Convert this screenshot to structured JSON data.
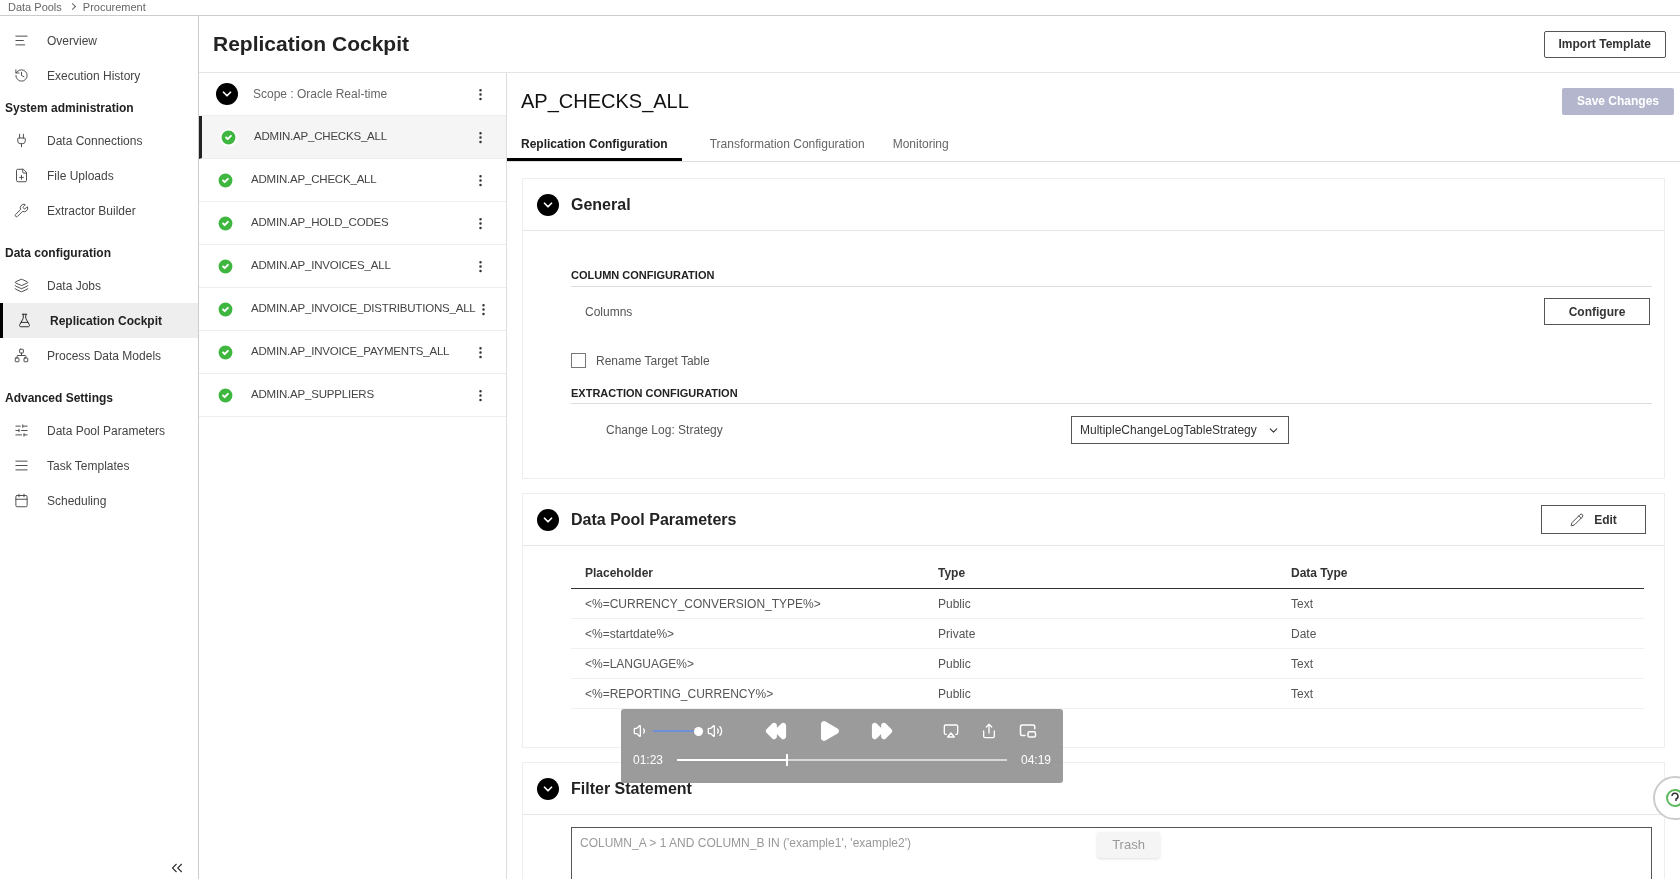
{
  "breadcrumb": [
    "Data Pools",
    "Procurement"
  ],
  "sidebar": {
    "groups": [
      {
        "items": [
          {
            "label": "Overview",
            "selected": false
          },
          {
            "label": "Execution History",
            "selected": false
          }
        ]
      },
      {
        "heading": "System administration",
        "items": [
          {
            "label": "Data Connections",
            "selected": false
          },
          {
            "label": "File Uploads",
            "selected": false
          },
          {
            "label": "Extractor Builder",
            "selected": false
          }
        ]
      },
      {
        "heading": "Data configuration",
        "items": [
          {
            "label": "Data Jobs",
            "selected": false
          },
          {
            "label": "Replication Cockpit",
            "selected": true
          },
          {
            "label": "Process Data Models",
            "selected": false
          }
        ]
      },
      {
        "heading": "Advanced Settings",
        "items": [
          {
            "label": "Data Pool Parameters",
            "selected": false
          },
          {
            "label": "Task Templates",
            "selected": false
          },
          {
            "label": "Scheduling",
            "selected": false
          }
        ]
      }
    ]
  },
  "page_title": "Replication Cockpit",
  "import_button": "Import Template",
  "scope": {
    "label": "Scope : Oracle Real-time",
    "expanded": true
  },
  "tables": [
    {
      "label": "ADMIN.AP_CHECKS_ALL",
      "success": true,
      "selected": true
    },
    {
      "label": "ADMIN.AP_CHECK_ALL",
      "success": true,
      "selected": false
    },
    {
      "label": "ADMIN.AP_HOLD_CODES",
      "success": true,
      "selected": false
    },
    {
      "label": "ADMIN.AP_INVOICES_ALL",
      "success": true,
      "selected": false
    },
    {
      "label": "ADMIN.AP_INVOICE_DISTRIBUTIONS_ALL",
      "success": true,
      "selected": false
    },
    {
      "label": "ADMIN.AP_INVOICE_PAYMENTS_ALL",
      "success": true,
      "selected": false
    },
    {
      "label": "ADMIN.AP_SUPPLIERS",
      "success": true,
      "selected": false
    }
  ],
  "detail": {
    "title": "AP_CHECKS_ALL",
    "save_button": {
      "label": "Save Changes",
      "disabled": true
    },
    "tabs": [
      {
        "label": "Replication Configuration",
        "selected": true
      },
      {
        "label": "Transformation Configuration",
        "selected": false
      },
      {
        "label": "Monitoring",
        "selected": false
      }
    ]
  },
  "general": {
    "title": "General",
    "expanded": true,
    "column_heading": "COLUMN CONFIGURATION",
    "columns_label": "Columns",
    "configure_button": "Configure",
    "rename": {
      "label": "Rename Target Table",
      "checked": false
    },
    "extraction_heading": "EXTRACTION CONFIGURATION",
    "strategy_label": "Change Log: Strategy",
    "strategy_value": "MultipleChangeLogTableStrategy"
  },
  "parameters": {
    "title": "Data Pool Parameters",
    "expanded": true,
    "edit_button": "Edit",
    "columns": [
      "Placeholder",
      "Type",
      "Data Type"
    ],
    "rows": [
      [
        "<%=CURRENCY_CONVERSION_TYPE%>",
        "Public",
        "Text"
      ],
      [
        "<%=startdate%>",
        "Private",
        "Date"
      ],
      [
        "<%=LANGUAGE%>",
        "Public",
        "Text"
      ],
      [
        "<%=REPORTING_CURRENCY%>",
        "Public",
        "Text"
      ]
    ]
  },
  "filter": {
    "title": "Filter Statement",
    "expanded": true,
    "placeholder": "COLUMN_A > 1 AND COLUMN_B IN ('example1', 'example2')"
  },
  "video_player": {
    "current_time": "01:23",
    "total_time": "04:19",
    "volume": {
      "level": 0.9
    },
    "progress": {
      "level": 0.33
    }
  },
  "tooltip": "Trash"
}
